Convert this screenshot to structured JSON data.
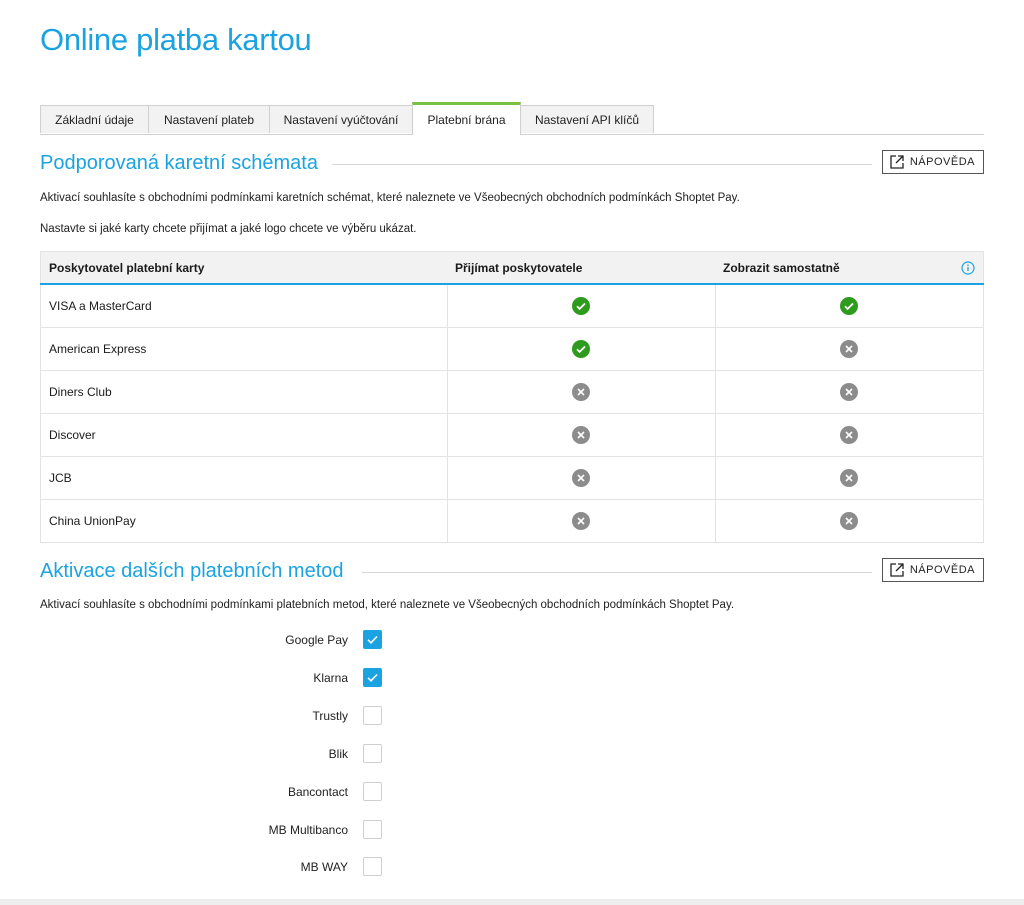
{
  "page": {
    "title": "Online platba kartou"
  },
  "tabs": [
    {
      "label": "Základní údaje",
      "active": false
    },
    {
      "label": "Nastavení plateb",
      "active": false
    },
    {
      "label": "Nastavení vyúčtování",
      "active": false
    },
    {
      "label": "Platební brána",
      "active": true
    },
    {
      "label": "Nastavení API klíčů",
      "active": false
    }
  ],
  "schemes": {
    "heading": "Podporovaná karetní schémata",
    "help_label": "NÁPOVĚDA",
    "intro1": "Aktivací souhlasíte s obchodními podmínkami karetních schémat, které naleznete ve Všeobecných obchodních podmínkách Shoptet Pay.",
    "intro2": "Nastavte si jaké karty chcete přijímat a jaké logo chcete ve výběru ukázat.",
    "columns": [
      "Poskytovatel platební karty",
      "Přijímat poskytovatele",
      "Zobrazit samostatně"
    ],
    "rows": [
      {
        "name": "VISA a MasterCard",
        "accept": true,
        "separate": true
      },
      {
        "name": "American Express",
        "accept": true,
        "separate": false
      },
      {
        "name": "Diners Club",
        "accept": false,
        "separate": false
      },
      {
        "name": "Discover",
        "accept": false,
        "separate": false
      },
      {
        "name": "JCB",
        "accept": false,
        "separate": false
      },
      {
        "name": "China UnionPay",
        "accept": false,
        "separate": false
      }
    ]
  },
  "methods": {
    "heading": "Aktivace dalších platebních metod",
    "help_label": "NÁPOVĚDA",
    "intro": "Aktivací souhlasíte s obchodními podmínkami platebních metod, které naleznete ve Všeobecných obchodních podmínkách Shoptet Pay.",
    "items": [
      {
        "label": "Google Pay",
        "checked": true
      },
      {
        "label": "Klarna",
        "checked": true
      },
      {
        "label": "Trustly",
        "checked": false
      },
      {
        "label": "Blik",
        "checked": false
      },
      {
        "label": "Bancontact",
        "checked": false
      },
      {
        "label": "MB Multibanco",
        "checked": false
      },
      {
        "label": "MB WAY",
        "checked": false
      }
    ]
  },
  "colors": {
    "accent": "#1aa3e0",
    "success": "#2e9b1e",
    "disabled": "#8c8c8c",
    "active_tab": "#7ac143"
  }
}
